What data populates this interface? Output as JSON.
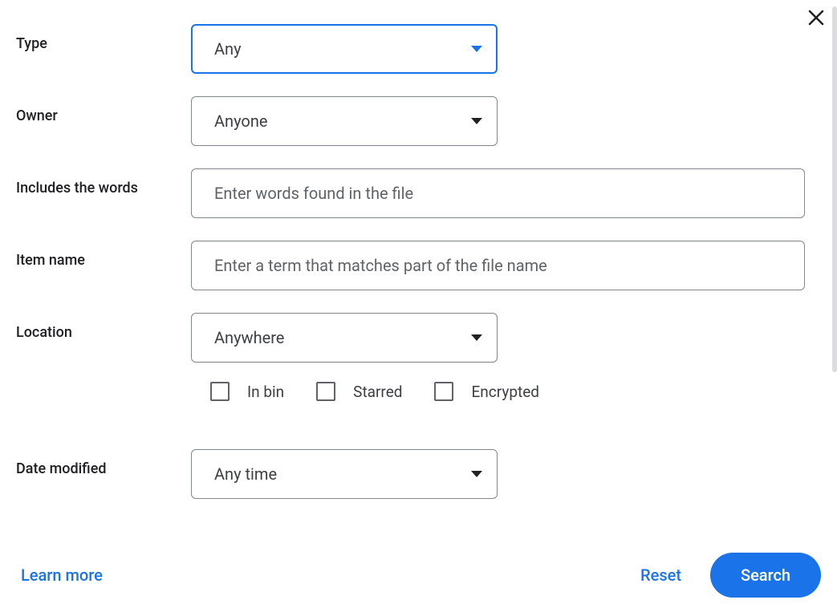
{
  "close_label": "Close",
  "fields": {
    "type": {
      "label": "Type",
      "value": "Any"
    },
    "owner": {
      "label": "Owner",
      "value": "Anyone"
    },
    "includes": {
      "label": "Includes the words",
      "placeholder": "Enter words found in the file"
    },
    "item_name": {
      "label": "Item name",
      "placeholder": "Enter a term that matches part of the file name"
    },
    "location": {
      "label": "Location",
      "value": "Anywhere"
    },
    "date_modified": {
      "label": "Date modified",
      "value": "Any time"
    }
  },
  "checkboxes": {
    "in_bin": "In bin",
    "starred": "Starred",
    "encrypted": "Encrypted"
  },
  "footer": {
    "learn_more": "Learn more",
    "reset": "Reset",
    "search": "Search"
  }
}
